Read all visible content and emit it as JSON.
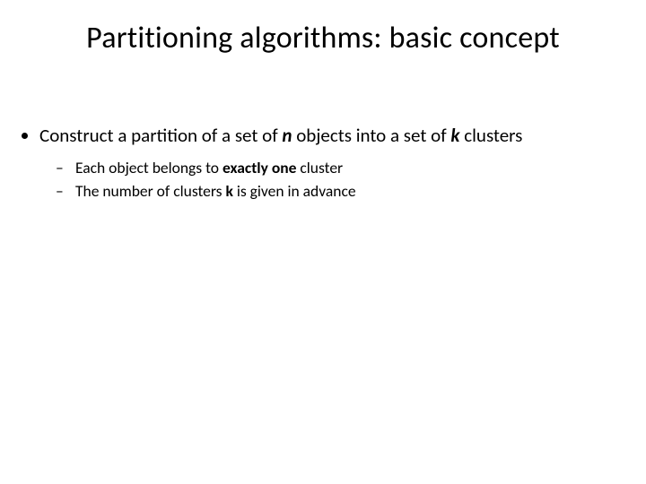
{
  "slide": {
    "title": "Partitioning algorithms: basic concept",
    "bullet1": {
      "t1": "Construct a partition of a set of ",
      "n": "n",
      "t2": " objects into a set of ",
      "k": "k",
      "t3": " clusters"
    },
    "sub1": {
      "t1": "Each object belongs to ",
      "b": "exactly one",
      "t2": " cluster"
    },
    "sub2": {
      "t1": "The number of clusters ",
      "k": "k",
      "t2": " is given in advance"
    }
  }
}
